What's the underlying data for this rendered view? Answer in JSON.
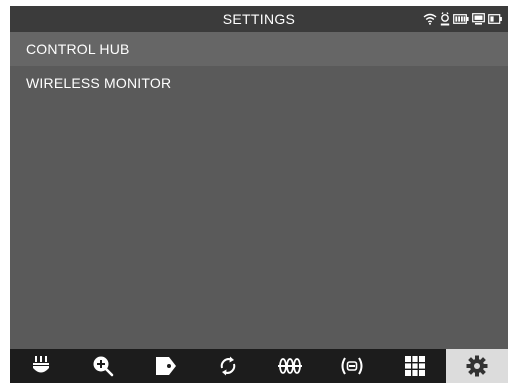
{
  "header": {
    "title": "SETTINGS",
    "status_icons": [
      "wifi-icon",
      "location-pin-icon",
      "battery-icon",
      "monitor-icon",
      "battery-small-icon"
    ]
  },
  "menu": {
    "items": [
      {
        "label": "CONTROL HUB"
      },
      {
        "label": "WIRELESS MONITOR"
      }
    ]
  },
  "toolbar": {
    "tools": [
      {
        "icon": "probe-icon"
      },
      {
        "icon": "zoom-in-icon"
      },
      {
        "icon": "tag-icon"
      },
      {
        "icon": "refresh-icon"
      },
      {
        "icon": "waveform-icon"
      },
      {
        "icon": "wireless-signal-icon"
      },
      {
        "icon": "grid-icon"
      },
      {
        "icon": "settings-gear-icon",
        "active": true
      }
    ]
  },
  "colors": {
    "background": "#5a5a5a",
    "title_bar": "#3b3b3b",
    "selected_row": "#666666",
    "toolbar": "#1c1c1c",
    "active_tool": "#dcdcdc"
  }
}
